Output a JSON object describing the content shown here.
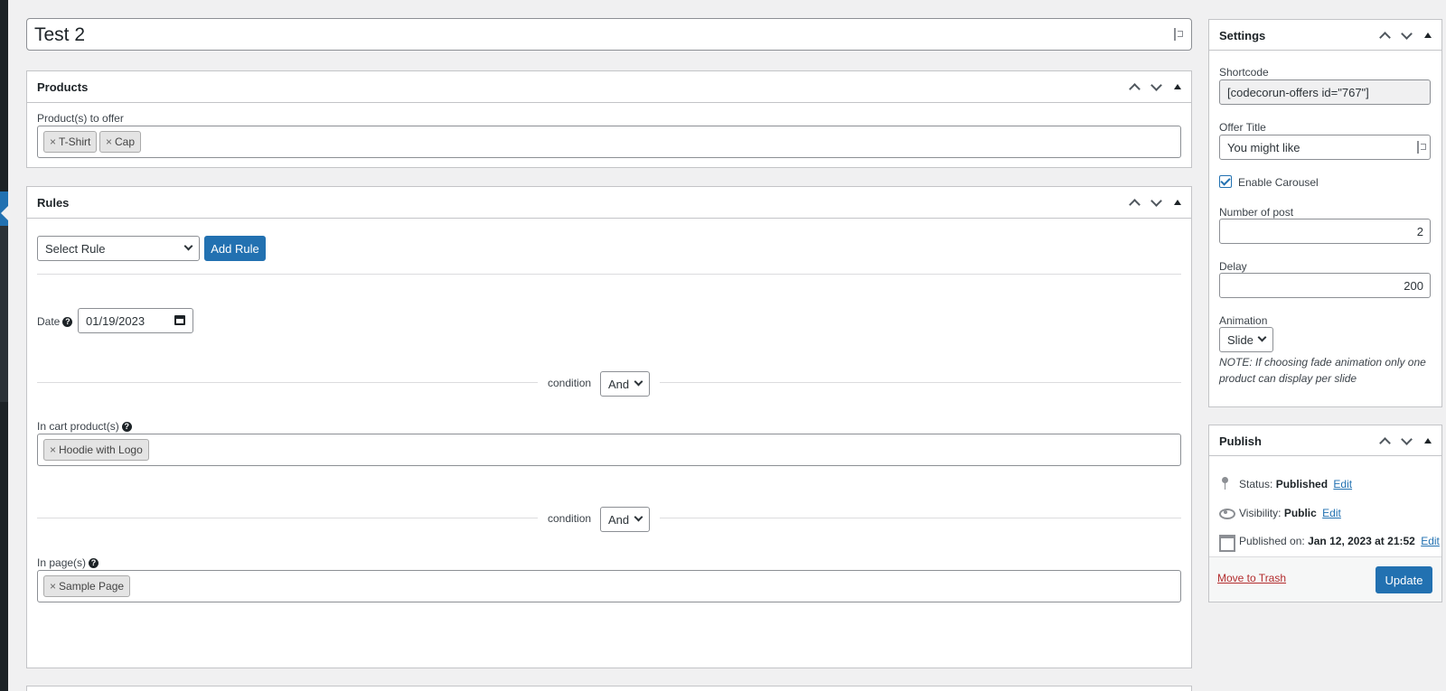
{
  "post_title": "Test 2",
  "products_box": {
    "title": "Products",
    "field_label": "Product(s) to offer",
    "tags": [
      "T-Shirt",
      "Cap"
    ]
  },
  "rules_box": {
    "title": "Rules",
    "select_rule": "Select Rule",
    "add_rule_label": "Add Rule",
    "date_label": "Date",
    "help_glyph": "?",
    "date_value": "01/19/2023",
    "condition_label": "condition",
    "condition_value_1": "And",
    "condition_value_2": "And",
    "cart_label": "In cart product(s)",
    "cart_tags": [
      "Hoodie with Logo"
    ],
    "pages_label": "In page(s)",
    "page_tags": [
      "Sample Page"
    ],
    "remove_glyph": "×"
  },
  "settings_box": {
    "title": "Settings",
    "shortcode_label": "Shortcode",
    "shortcode_value": "[codecorun-offers id=\"767\"]",
    "offer_title_label": "Offer Title",
    "offer_title_value": "You might like",
    "carousel_label": "Enable Carousel",
    "carousel_checked": true,
    "num_post_label": "Number of post",
    "num_post_value": "2",
    "delay_label": "Delay",
    "delay_value": "200",
    "animation_label": "Animation",
    "animation_value": "Slide",
    "note": "NOTE: If choosing fade animation only one product can display per slide"
  },
  "publish_box": {
    "title": "Publish",
    "status_label": "Status:",
    "status_value": "Published",
    "visibility_label": "Visibility:",
    "visibility_value": "Public",
    "published_label": "Published on:",
    "published_value": "Jan 12, 2023 at 21:52",
    "edit_label": "Edit",
    "trash_label": "Move to Trash",
    "update_label": "Update"
  },
  "colors": {
    "accent": "#2271b1",
    "danger": "#b32d2e",
    "background": "#f0f0f1",
    "admin_menu": "#1d2327"
  }
}
